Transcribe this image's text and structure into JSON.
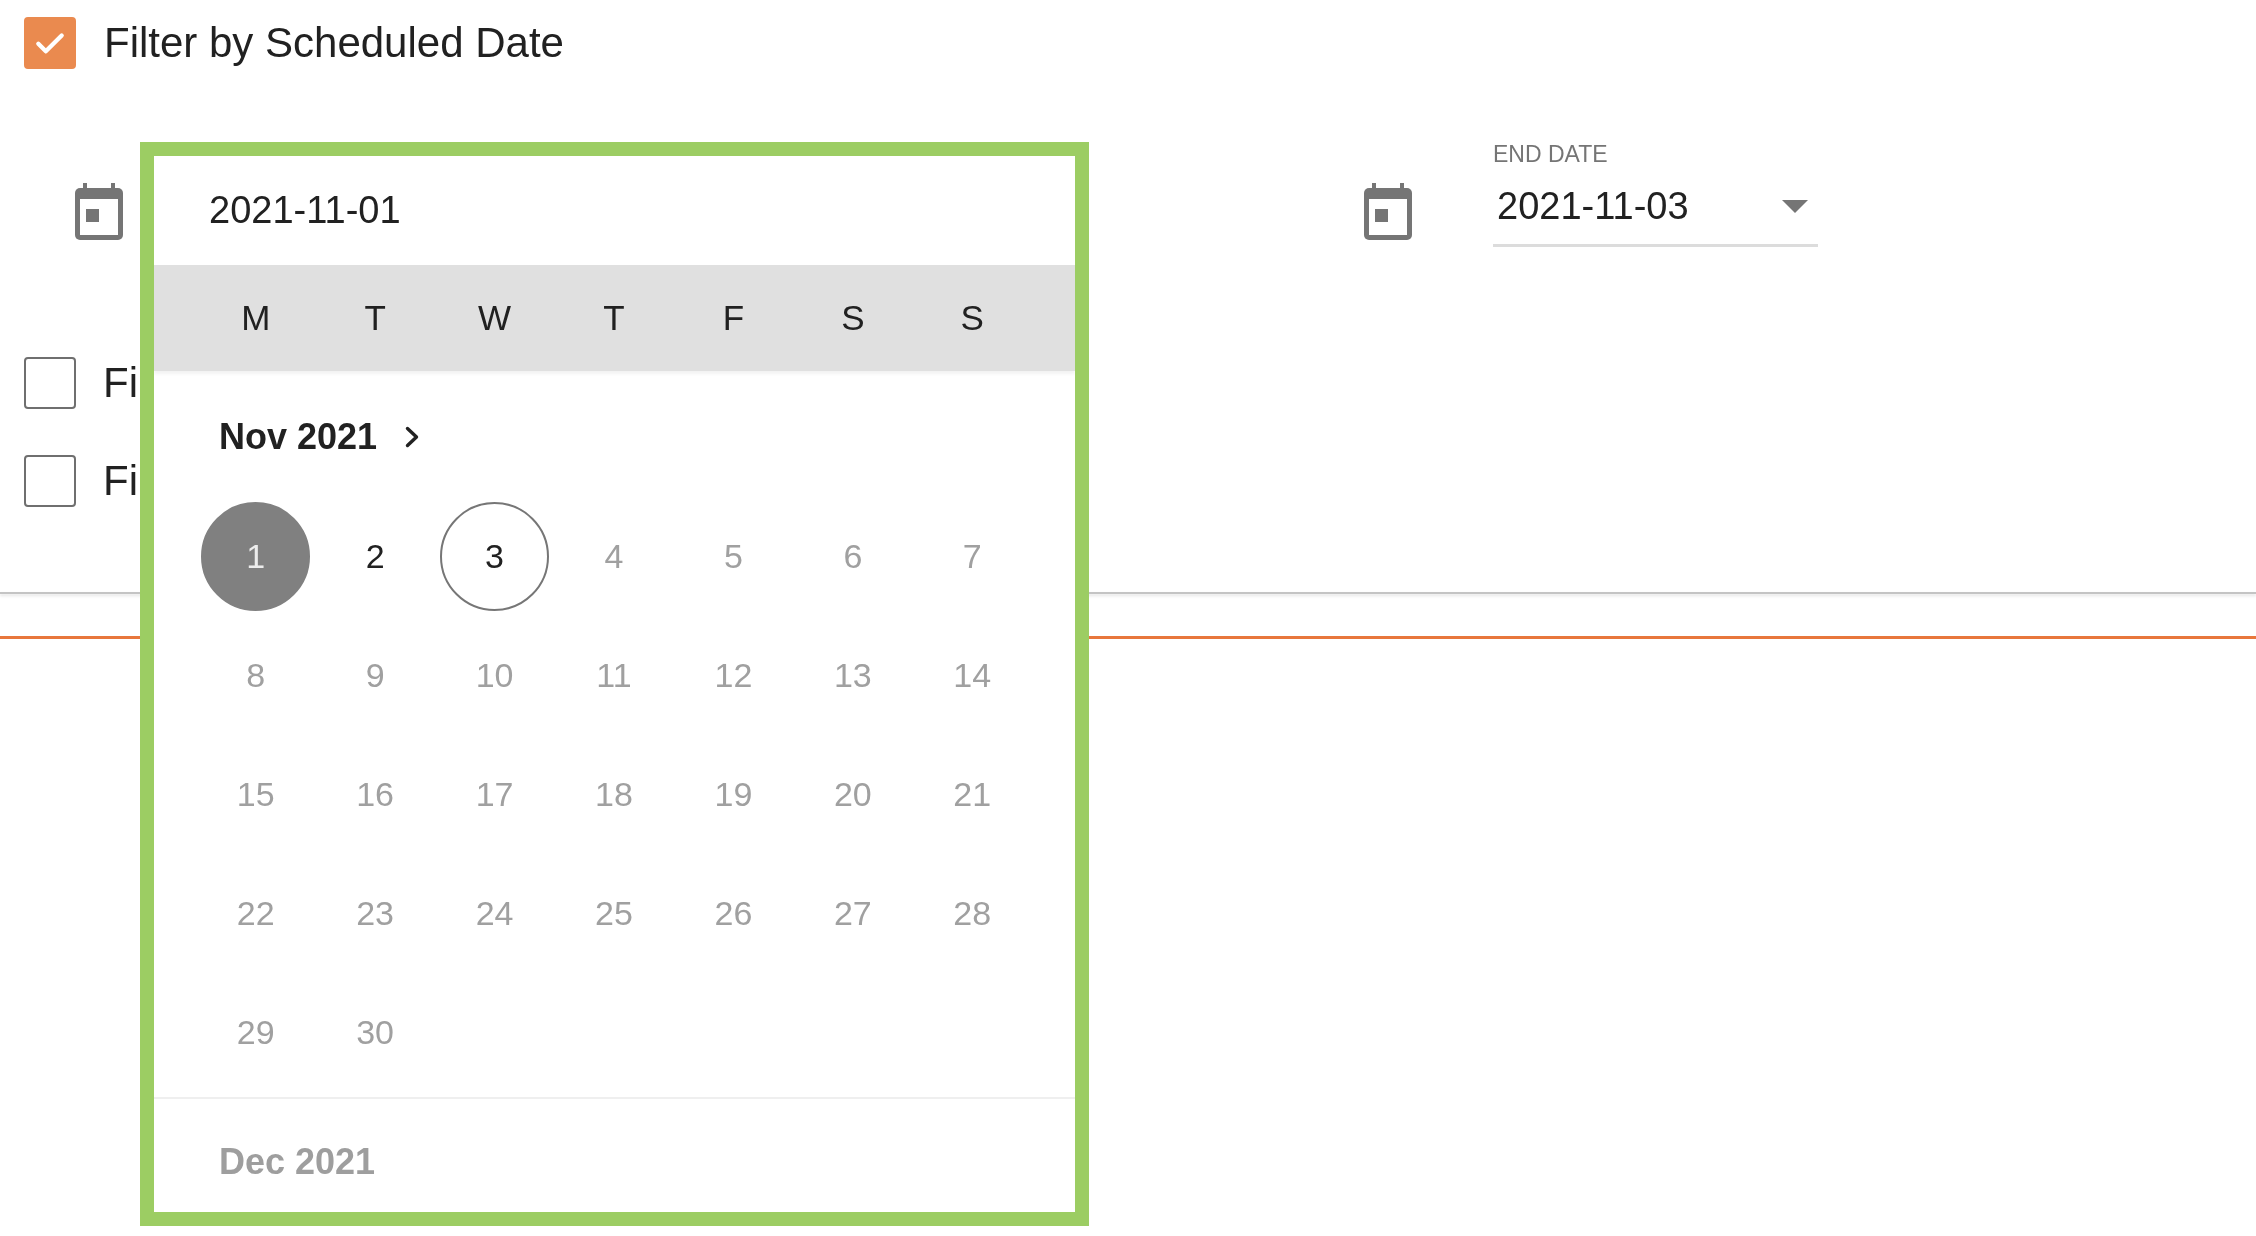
{
  "filter": {
    "label": "Filter by Scheduled Date",
    "checked": true
  },
  "date_picker": {
    "value": "2021-11-01",
    "weekdays": [
      "M",
      "T",
      "W",
      "T",
      "F",
      "S",
      "S"
    ],
    "months": [
      {
        "title": "Nov 2021",
        "disabled": false,
        "days": [
          {
            "label": "1",
            "selected": true,
            "disabled": false,
            "is_end_date": false
          },
          {
            "label": "2",
            "selected": false,
            "disabled": false,
            "is_end_date": false
          },
          {
            "label": "3",
            "selected": false,
            "disabled": false,
            "is_end_date": true
          },
          {
            "label": "4",
            "selected": false,
            "disabled": true,
            "is_end_date": false
          },
          {
            "label": "5",
            "selected": false,
            "disabled": true,
            "is_end_date": false
          },
          {
            "label": "6",
            "selected": false,
            "disabled": true,
            "is_end_date": false
          },
          {
            "label": "7",
            "selected": false,
            "disabled": true,
            "is_end_date": false
          },
          {
            "label": "8",
            "selected": false,
            "disabled": true,
            "is_end_date": false
          },
          {
            "label": "9",
            "selected": false,
            "disabled": true,
            "is_end_date": false
          },
          {
            "label": "10",
            "selected": false,
            "disabled": true,
            "is_end_date": false
          },
          {
            "label": "11",
            "selected": false,
            "disabled": true,
            "is_end_date": false
          },
          {
            "label": "12",
            "selected": false,
            "disabled": true,
            "is_end_date": false
          },
          {
            "label": "13",
            "selected": false,
            "disabled": true,
            "is_end_date": false
          },
          {
            "label": "14",
            "selected": false,
            "disabled": true,
            "is_end_date": false
          },
          {
            "label": "15",
            "selected": false,
            "disabled": true,
            "is_end_date": false
          },
          {
            "label": "16",
            "selected": false,
            "disabled": true,
            "is_end_date": false
          },
          {
            "label": "17",
            "selected": false,
            "disabled": true,
            "is_end_date": false
          },
          {
            "label": "18",
            "selected": false,
            "disabled": true,
            "is_end_date": false
          },
          {
            "label": "19",
            "selected": false,
            "disabled": true,
            "is_end_date": false
          },
          {
            "label": "20",
            "selected": false,
            "disabled": true,
            "is_end_date": false
          },
          {
            "label": "21",
            "selected": false,
            "disabled": true,
            "is_end_date": false
          },
          {
            "label": "22",
            "selected": false,
            "disabled": true,
            "is_end_date": false
          },
          {
            "label": "23",
            "selected": false,
            "disabled": true,
            "is_end_date": false
          },
          {
            "label": "24",
            "selected": false,
            "disabled": true,
            "is_end_date": false
          },
          {
            "label": "25",
            "selected": false,
            "disabled": true,
            "is_end_date": false
          },
          {
            "label": "26",
            "selected": false,
            "disabled": true,
            "is_end_date": false
          },
          {
            "label": "27",
            "selected": false,
            "disabled": true,
            "is_end_date": false
          },
          {
            "label": "28",
            "selected": false,
            "disabled": true,
            "is_end_date": false
          },
          {
            "label": "29",
            "selected": false,
            "disabled": true,
            "is_end_date": false
          },
          {
            "label": "30",
            "selected": false,
            "disabled": true,
            "is_end_date": false
          }
        ]
      },
      {
        "title": "Dec 2021",
        "disabled": true
      }
    ]
  },
  "end_date": {
    "label": "END DATE",
    "value": "2021-11-03"
  },
  "other_filters": [
    {
      "label": "Fi",
      "checked": false
    },
    {
      "label": "Fi",
      "checked": false
    }
  ]
}
